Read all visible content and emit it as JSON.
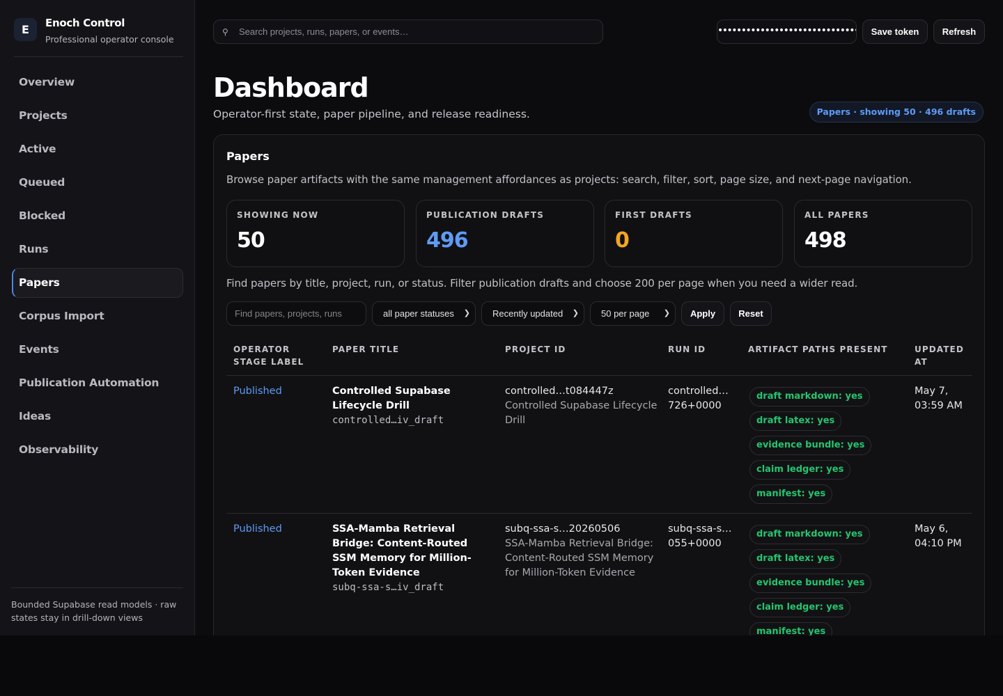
{
  "brand": {
    "logo_letter": "E",
    "title": "Enoch Control",
    "subtitle": "Professional operator console"
  },
  "nav": [
    {
      "label": "Overview"
    },
    {
      "label": "Projects"
    },
    {
      "label": "Active"
    },
    {
      "label": "Queued"
    },
    {
      "label": "Blocked"
    },
    {
      "label": "Runs"
    },
    {
      "label": "Papers",
      "active": true
    },
    {
      "label": "Corpus Import"
    },
    {
      "label": "Events"
    },
    {
      "label": "Publication Automation"
    },
    {
      "label": "Ideas"
    },
    {
      "label": "Observability"
    }
  ],
  "sidebar_footer": "Bounded Supabase read models · raw states stay in drill-down views",
  "topbar": {
    "search_placeholder": "Search projects, runs, papers, or events…",
    "token_masked": "••••••••••••••••••••••••••••••••••••••••",
    "save_label": "Save token",
    "refresh_label": "Refresh"
  },
  "header": {
    "title": "Dashboard",
    "subtitle": "Operator-first state, paper pipeline, and release readiness.",
    "pill": "Papers · showing 50 · 496 drafts"
  },
  "panel": {
    "title": "Papers",
    "description": "Browse paper artifacts with the same management affordances as projects: search, filter, sort, page size, and next-page navigation.",
    "hint": "Find papers by title, project, run, or status. Filter publication drafts and choose 200 per page when you need a wider read."
  },
  "stats": [
    {
      "label": "SHOWING NOW",
      "value": "50",
      "color": "#ffffff"
    },
    {
      "label": "PUBLICATION DRAFTS",
      "value": "496",
      "color": "#5f9bf5"
    },
    {
      "label": "FIRST DRAFTS",
      "value": "0",
      "color": "#f5a524"
    },
    {
      "label": "ALL PAPERS",
      "value": "498",
      "color": "#ffffff"
    }
  ],
  "filters": {
    "search_placeholder": "Find papers, projects, runs",
    "status": "all paper statuses",
    "sort": "Recently updated",
    "page_size": "50 per page",
    "apply_label": "Apply",
    "reset_label": "Reset"
  },
  "table": {
    "headers": [
      "OPERATOR STAGE LABEL",
      "PAPER TITLE",
      "PROJECT ID",
      "RUN ID",
      "ARTIFACT PATHS PRESENT",
      "UPDATED AT"
    ],
    "rows": [
      {
        "stage": "Published",
        "title": "Controlled Supabase Lifecycle Drill",
        "title_id": "controlled…iv_draft",
        "project_id": "controlled…t084447z",
        "project_name": "Controlled Supabase Lifecycle Drill",
        "run_id": "controlled… 726+0000",
        "artifacts": [
          "draft markdown: yes",
          "draft latex: yes",
          "evidence bundle: yes",
          "claim ledger: yes",
          "manifest: yes"
        ],
        "updated": "May 7, 03:59 AM"
      },
      {
        "stage": "Published",
        "title": "SSA-Mamba Retrieval Bridge: Content-Routed SSM Memory for Million-Token Evidence",
        "title_id": "subq-ssa-s…iv_draft",
        "project_id": "subq-ssa-s…20260506",
        "project_name": "SSA-Mamba Retrieval Bridge: Content-Routed SSM Memory for Million-Token Evidence",
        "run_id": "subq-ssa-s… 055+0000",
        "artifacts": [
          "draft markdown: yes",
          "draft latex: yes",
          "evidence bundle: yes",
          "claim ledger: yes",
          "manifest: yes"
        ],
        "updated": "May 6, 04:10 PM"
      }
    ]
  },
  "colors": {
    "accent": "#4f86e8",
    "link": "#5f9bf5",
    "success": "#27c46e",
    "warning": "#f5a524"
  }
}
